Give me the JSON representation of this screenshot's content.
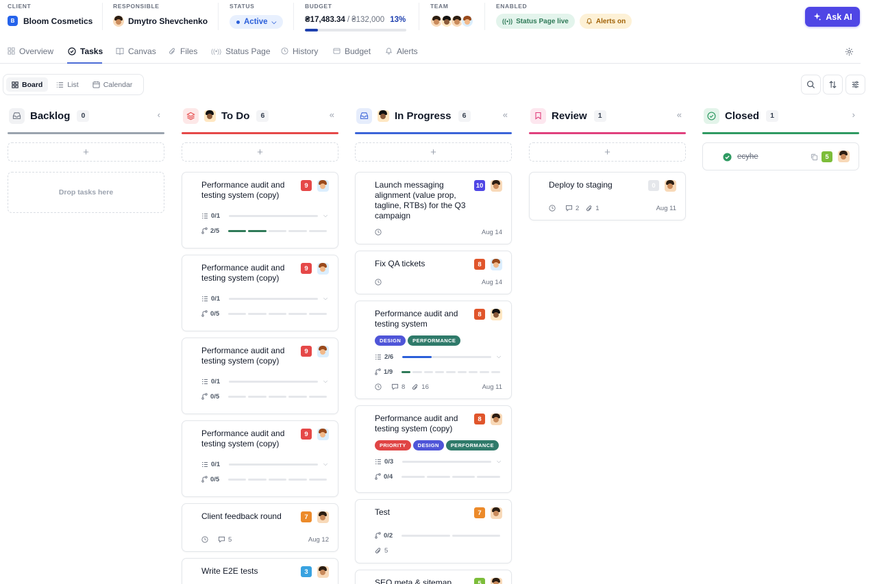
{
  "header": {
    "client_label": "CLIENT",
    "client_initial": "B",
    "client_name": "Bloom Cosmetics",
    "responsible_label": "RESPONSIBLE",
    "responsible_name": "Dmytro Shevchenko",
    "status_label": "STATUS",
    "status_value": "Active",
    "budget_label": "BUDGET",
    "budget_spent": "₴17,483.34",
    "budget_total": "/ ₴132,000",
    "budget_percent": "13%",
    "budget_progress": 0.13,
    "team_label": "TEAM",
    "enabled_label": "ENABLED",
    "status_page_badge": "Status Page live",
    "alerts_badge": "Alerts on",
    "ask_ai_label": "Ask AI"
  },
  "nav": {
    "tabs": [
      "Overview",
      "Tasks",
      "Canvas",
      "Files",
      "Status Page",
      "History",
      "Budget",
      "Alerts"
    ],
    "active": "Tasks"
  },
  "views": [
    "Board",
    "List",
    "Calendar"
  ],
  "board": {
    "drop_placeholder": "Drop tasks here",
    "add_label": "+",
    "columns": [
      {
        "title": "Backlog",
        "count": "0",
        "collapse": "‹"
      },
      {
        "title": "To Do",
        "count": "6",
        "collapse": "«"
      },
      {
        "title": "In Progress",
        "count": "6",
        "collapse": "«"
      },
      {
        "title": "Review",
        "count": "1",
        "collapse": "«"
      },
      {
        "title": "Closed",
        "count": "1",
        "collapse": "›"
      }
    ]
  },
  "todo": [
    {
      "title": "Performance audit and testing system (copy)",
      "prio": "9",
      "checklist": "0/1",
      "subtasks": "2/5"
    },
    {
      "title": "Performance audit and testing system (copy)",
      "prio": "9",
      "checklist": "0/1",
      "subtasks": "0/5"
    },
    {
      "title": "Performance audit and testing system (copy)",
      "prio": "9",
      "checklist": "0/1",
      "subtasks": "0/5"
    },
    {
      "title": "Performance audit and testing system (copy)",
      "prio": "9",
      "checklist": "0/1",
      "subtasks": "0/5"
    },
    {
      "title": "Client feedback round",
      "prio": "7",
      "comments": "5",
      "date": "Aug 12"
    },
    {
      "title": "Write E2E tests",
      "prio": "3"
    }
  ],
  "inprogress": [
    {
      "title": "Launch messaging alignment (value prop, tagline, RTBs) for the Q3 campaign",
      "prio": "10",
      "date": "Aug 14"
    },
    {
      "title": "Fix QA tickets",
      "prio": "8",
      "date": "Aug 14"
    },
    {
      "title": "Performance audit and testing system",
      "prio": "8",
      "tags": [
        "DESIGN",
        "PERFORMANCE"
      ],
      "checklist": "2/6",
      "checklist_progress": 0.33,
      "subtasks": "1/9",
      "comments": "8",
      "attachments": "16",
      "date": "Aug 11"
    },
    {
      "title": "Performance audit and testing system (copy)",
      "prio": "8",
      "tags": [
        "PRIORITY",
        "DESIGN",
        "PERFORMANCE"
      ],
      "checklist": "0/3",
      "subtasks": "0/4"
    },
    {
      "title": "Test",
      "prio": "7",
      "subtasks": "0/2",
      "attachments": "5"
    },
    {
      "title": "SEO meta & sitemap",
      "prio": "5"
    }
  ],
  "review": [
    {
      "title": "Deploy to staging",
      "prio": "0",
      "comments": "2",
      "attachments": "1",
      "date": "Aug 11"
    }
  ],
  "closed": [
    {
      "title": "ecyhe",
      "prio": "5"
    }
  ],
  "colors": {
    "accent": "#4f46e5",
    "todo": "#e54848",
    "inprogress": "#3b64d8",
    "review": "#e0407d",
    "closed": "#2f9a62",
    "backlog": "#9aa3ae"
  }
}
